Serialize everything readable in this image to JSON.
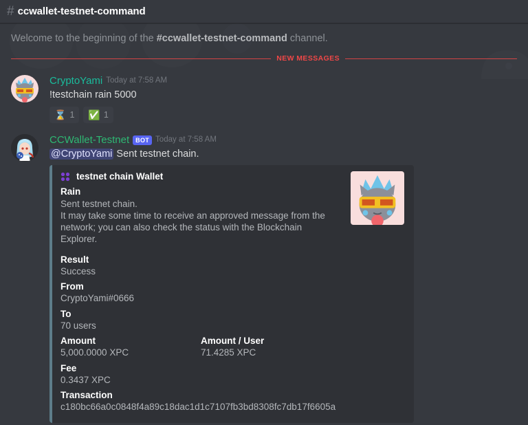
{
  "header": {
    "hash_icon": "hash-icon",
    "channel_name": "ccwallet-testnet-command"
  },
  "welcome": {
    "prefix": "Welcome to the beginning of the ",
    "channel": "#ccwallet-testnet-command",
    "suffix": " channel."
  },
  "new_messages_divider": {
    "label": "NEW MESSAGES",
    "color": "#f04747"
  },
  "messages": [
    {
      "author": "CryptoYami",
      "author_color": "#1abc9c",
      "timestamp": "Today at 7:58 AM",
      "is_bot": false,
      "content": "!testchain rain 5000",
      "reactions": [
        {
          "emoji": "⌛",
          "name": "hourglass-reaction",
          "count": "1"
        },
        {
          "emoji": "✅",
          "name": "check-mark-reaction",
          "count": "1"
        }
      ]
    },
    {
      "author": "CCWallet-Testnet",
      "author_color": "#2eb873",
      "bot_tag": "BOT",
      "timestamp": "Today at 7:58 AM",
      "is_bot": true,
      "mention": "@CryptoYami",
      "content": " Sent testnet chain."
    }
  ],
  "embed": {
    "accent_color": "#5d7d8a",
    "author_icon": "grid-dots-icon",
    "author_name": "testnet chain Wallet",
    "title": "Rain",
    "description": "Sent testnet chain.\nIt may take some time to receive an approved message from the\nnetwork; you can also check the status with the Blockchain Explorer.",
    "fields": [
      {
        "name": "Result",
        "value": "Success",
        "inline": false
      },
      {
        "name": "From",
        "value": "CryptoYami#0666",
        "inline": false
      },
      {
        "name": "To",
        "value": "70 users",
        "inline": false
      },
      {
        "name": "Amount",
        "value": "5,000.0000 XPC",
        "inline": true
      },
      {
        "name": "Amount / User",
        "value": "71.4285 XPC",
        "inline": true
      },
      {
        "name": "Fee",
        "value": "0.3437 XPC",
        "inline": false
      },
      {
        "name": "Transaction",
        "value": "c180bc66a0c0848f4a89c18dac1d1c7107fb3bd8308fc7db17f6605a",
        "inline": false
      }
    ],
    "thumbnail": "cat-sunglasses-avatar"
  }
}
